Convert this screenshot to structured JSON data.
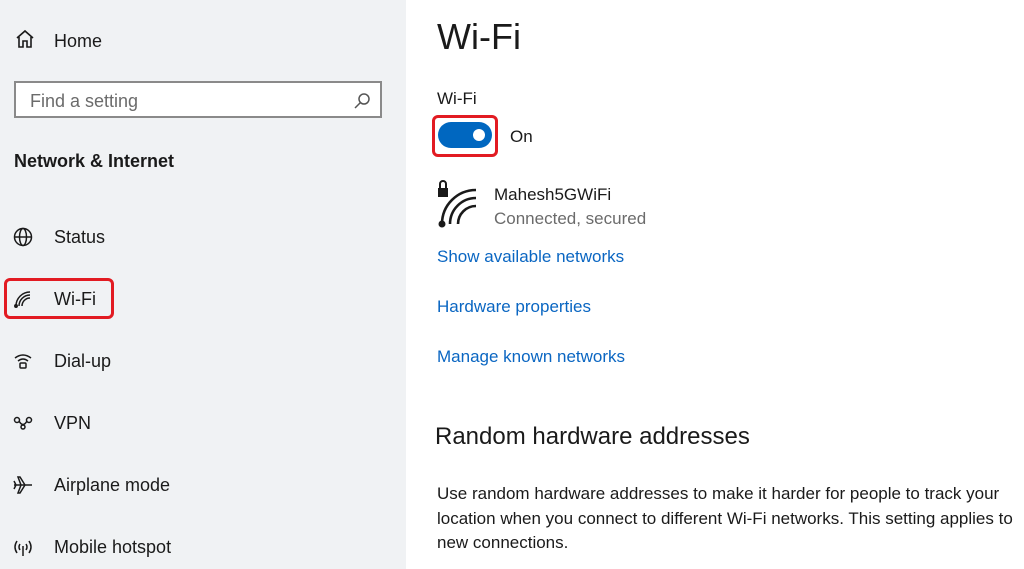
{
  "sidebar": {
    "home_label": "Home",
    "search": {
      "placeholder": "Find a setting"
    },
    "section_title": "Network & Internet",
    "items": [
      {
        "label": "Status",
        "icon": "globe-icon"
      },
      {
        "label": "Wi-Fi",
        "icon": "wifi-icon",
        "selected": true
      },
      {
        "label": "Dial-up",
        "icon": "dialup-icon"
      },
      {
        "label": "VPN",
        "icon": "vpn-icon"
      },
      {
        "label": "Airplane mode",
        "icon": "airplane-icon"
      },
      {
        "label": "Mobile hotspot",
        "icon": "hotspot-icon"
      }
    ]
  },
  "main": {
    "title": "Wi-Fi",
    "wifi_section_label": "Wi-Fi",
    "toggle": {
      "state_label": "On",
      "is_on": true
    },
    "network": {
      "name": "Mahesh5GWiFi",
      "status": "Connected, secured"
    },
    "links": {
      "show_available": "Show available networks",
      "hardware_properties": "Hardware properties",
      "manage_known": "Manage known networks"
    },
    "random_hw": {
      "title": "Random hardware addresses",
      "description": "Use random hardware addresses to make it harder for people to track your location when you connect to different Wi-Fi networks. This setting applies to new connections."
    }
  },
  "colors": {
    "accent": "#0067c0",
    "link": "#0a66c2",
    "highlight": "#e21b22",
    "sidebar_bg": "#f0f2f4"
  }
}
